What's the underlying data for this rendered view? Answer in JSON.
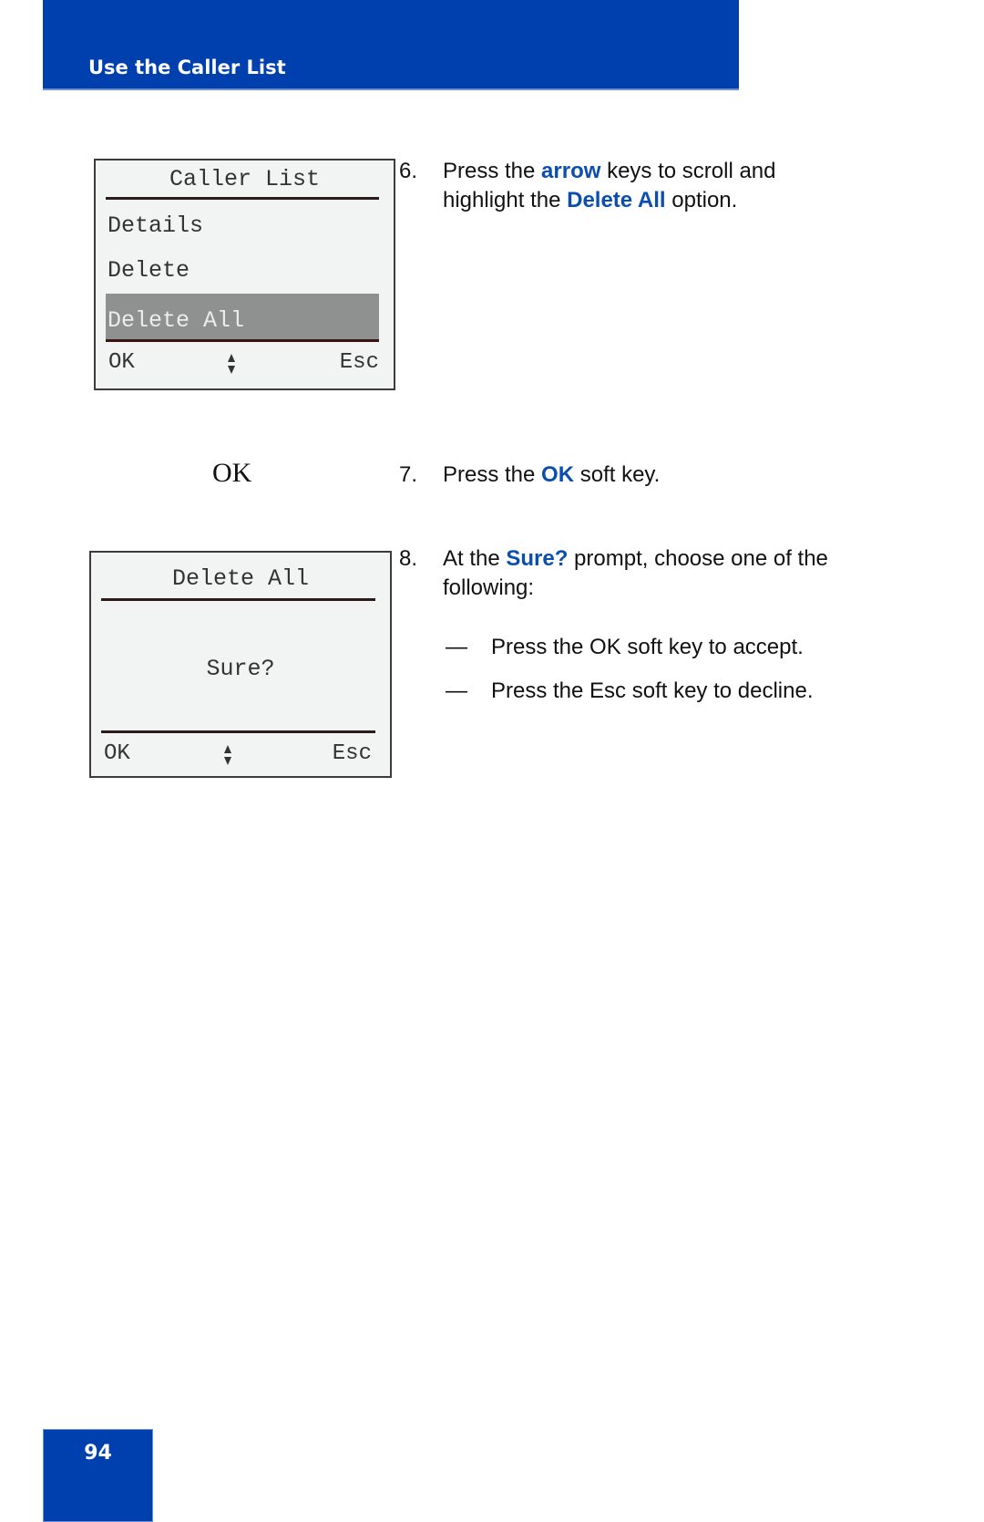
{
  "header": {
    "title": "Use the Caller List"
  },
  "screen1": {
    "title": "Caller List",
    "items": [
      "Details",
      "Delete",
      "Delete All"
    ],
    "selected_item": "Delete All",
    "softkeys": {
      "left": "OK",
      "right": "Esc",
      "center_icon": "up-down-arrows-icon"
    }
  },
  "screen2": {
    "title": "Delete All",
    "prompt": "Sure?",
    "softkeys": {
      "left": "OK",
      "right": "Esc",
      "center_icon": "up-down-arrows-icon"
    }
  },
  "ok_key_label": "OK",
  "steps": [
    {
      "number": "6.",
      "line1": {
        "pre": "Press the ",
        "em": "arrow",
        "post": " keys to scroll and"
      },
      "line2": {
        "pre": "highlight the ",
        "em": "Delete All",
        "post": " option."
      }
    },
    {
      "number": "7.",
      "line1": {
        "pre": "Press the ",
        "em": "OK",
        "post": " soft key."
      }
    },
    {
      "number": "8.",
      "line1": {
        "pre": "At the ",
        "em": "Sure?",
        "post": " prompt, choose one of the"
      },
      "line2": {
        "text": "following:"
      },
      "options": [
        {
          "dash": "—",
          "text": "Press the OK soft key to accept."
        },
        {
          "dash": "—",
          "text": "Press the Esc soft key to decline."
        }
      ]
    }
  ],
  "page_number": "94",
  "colors": {
    "brand_blue": "#0040ae",
    "highlight_text": "#0a4fb0",
    "selection_gray": "#8f9090"
  }
}
